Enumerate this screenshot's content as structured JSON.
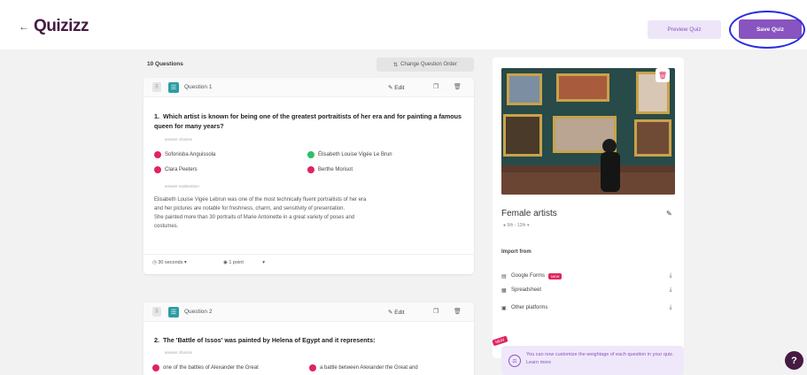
{
  "header": {
    "back_icon": "←",
    "logo": "Quizizz",
    "preview_label": "Preview Quiz",
    "save_label": "Save Quiz"
  },
  "questions_header": {
    "count": "10 Questions",
    "reorder_label": "Change Question Order"
  },
  "questions": [
    {
      "label": "Question 1",
      "edit_label": "Edit",
      "number": "1.",
      "text": "Which artist is known for being one of the greatest portraitists of her era and for painting a famous queen for many years?",
      "choices_caption": "answer choices",
      "choices": [
        {
          "text": "Sofonisba Anguissola",
          "correct": false
        },
        {
          "text": "Élisabeth Louise Vigée Le Brun",
          "correct": true
        },
        {
          "text": "Clara Peeters",
          "correct": false
        },
        {
          "text": "Berthe Morisot",
          "correct": false
        }
      ],
      "explanation_caption": "answer explanation",
      "explanation": [
        "Elisabeth Louise Vigée Lebrun was one of the most technically fluent portraitists of her era",
        "and her pictures are notable for freshness, charm, and sensitivity of presentation.",
        "She painted more than 30 portraits of Marie Antoinette in a great variety of poses and",
        "costumes."
      ],
      "time": "30 seconds",
      "points": "1 point"
    },
    {
      "label": "Question 2",
      "edit_label": "Edit",
      "number": "2.",
      "text": "The 'Battle of Issos' was painted by Helena of Egypt and it represents:",
      "choices_caption": "answer choices",
      "choices": [
        {
          "text": "one of the battles of Alexander the Great",
          "correct": false
        },
        {
          "text": "a battle between Alexander the Great and",
          "correct": false
        }
      ]
    }
  ],
  "side": {
    "quiz_name": "Female artists",
    "grade": "9th - 12th",
    "import_title": "Import from",
    "imports": [
      {
        "icon": "google-forms-icon",
        "label": "Google Forms",
        "badge": "NEW"
      },
      {
        "icon": "spreadsheet-icon",
        "label": "Spreadsheet",
        "badge": ""
      },
      {
        "icon": "other-platforms-icon",
        "label": "Other platforms",
        "badge": ""
      }
    ],
    "tip_badge": "NEW",
    "tip_text": "You can now customize the weightage of each question in your quiz. Learn more"
  },
  "colors": {
    "brand": "#8854c0",
    "logo": "#461a42",
    "correct": "#2dbe6c",
    "incorrect": "#e0245e",
    "annotation_ring": "#2b2ee0"
  }
}
